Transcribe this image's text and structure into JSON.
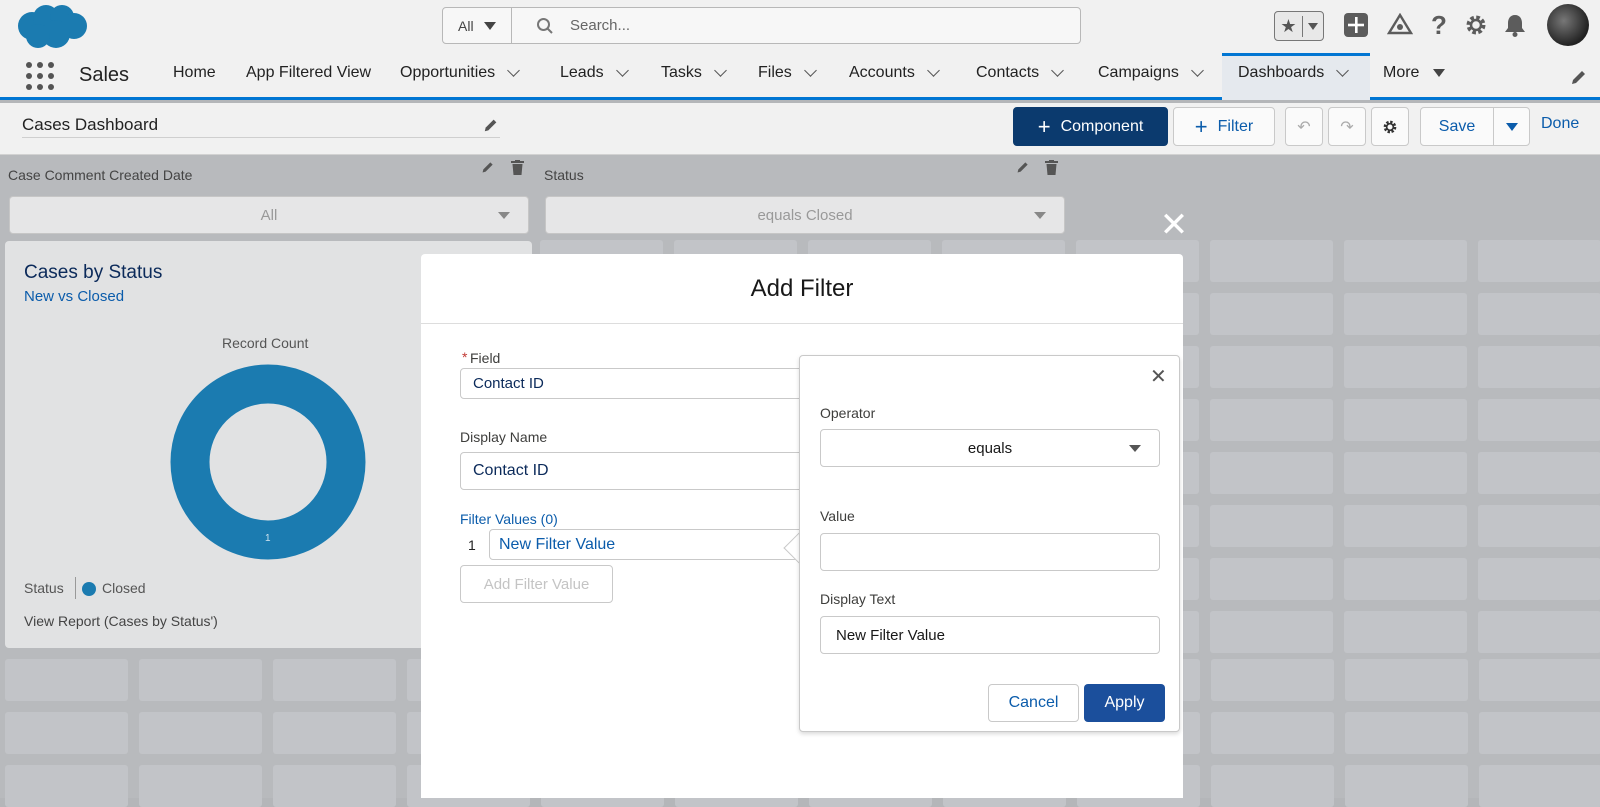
{
  "header": {
    "search_scope": "All",
    "search_placeholder": "Search...",
    "app_name": "Sales",
    "nav_items": [
      "Home",
      "App Filtered View",
      "Opportunities",
      "Leads",
      "Tasks",
      "Files",
      "Accounts",
      "Contacts",
      "Campaigns",
      "Dashboards",
      "More"
    ],
    "active_nav": "Dashboards"
  },
  "toolbar": {
    "dashboard_title": "Cases Dashboard",
    "component_label": "Component",
    "filter_label": "Filter",
    "save_label": "Save",
    "done_label": "Done"
  },
  "dashboard": {
    "filters": [
      {
        "label": "Case Comment Created Date",
        "value": "All"
      },
      {
        "label": "Status",
        "value": "equals Closed"
      }
    ],
    "card": {
      "title": "Cases by Status",
      "subtitle": "New vs Closed",
      "chart_label": "Record Count",
      "legend_title": "Status",
      "legend_item": "Closed",
      "report_link": "View Report (Cases by Status')",
      "donut_value": "1",
      "donut_color": "#1b7bb0"
    }
  },
  "modal": {
    "title": "Add Filter",
    "required_mark": "*",
    "field_label": "Field",
    "field_value": "Contact ID",
    "display_name_label": "Display Name",
    "display_name_value": "Contact ID",
    "filter_values_label": "Filter Values (0)",
    "filter_value_index": "1",
    "filter_value_text": "New Filter Value",
    "add_filter_value_label": "Add Filter Value"
  },
  "popover": {
    "operator_label": "Operator",
    "operator_value": "equals",
    "value_label": "Value",
    "value_value": "",
    "display_text_label": "Display Text",
    "display_text_value": "New Filter Value",
    "cancel_label": "Cancel",
    "apply_label": "Apply"
  },
  "colors": {
    "brand": "#0b3a6e",
    "link": "#0176d3",
    "apply": "#1b4f9c"
  }
}
